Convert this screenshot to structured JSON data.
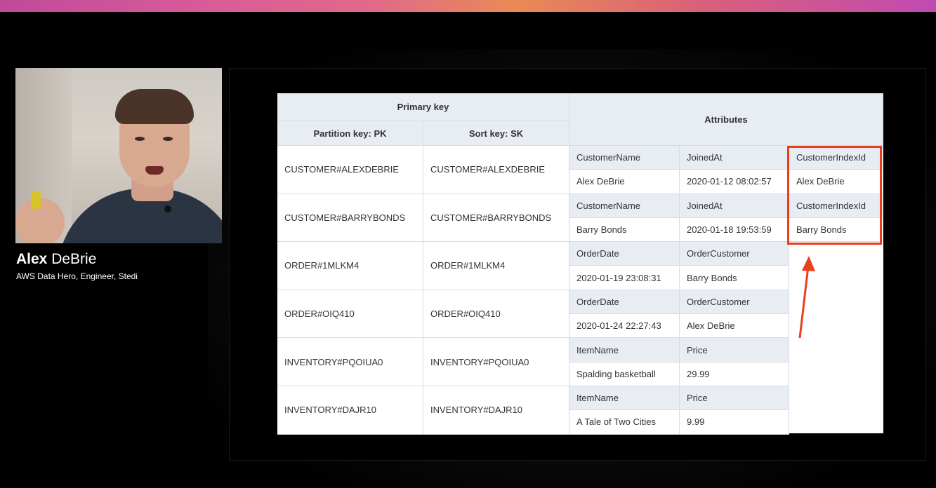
{
  "speaker": {
    "first_name": "Alex",
    "last_name": "DeBrie",
    "title": "AWS Data Hero, Engineer, Stedi"
  },
  "table": {
    "header_primary_key": "Primary key",
    "header_partition_key": "Partition key: PK",
    "header_sort_key": "Sort key: SK",
    "header_attributes": "Attributes",
    "items": [
      {
        "pk": "CUSTOMER#ALEXDEBRIE",
        "sk": "CUSTOMER#ALEXDEBRIE",
        "a1_name": "CustomerName",
        "a1_val": "Alex DeBrie",
        "a2_name": "JoinedAt",
        "a2_val": "2020-01-12 08:02:57",
        "a3_name": "CustomerIndexId",
        "a3_val": "Alex DeBrie"
      },
      {
        "pk": "CUSTOMER#BARRYBONDS",
        "sk": "CUSTOMER#BARRYBONDS",
        "a1_name": "CustomerName",
        "a1_val": "Barry Bonds",
        "a2_name": "JoinedAt",
        "a2_val": "2020-01-18 19:53:59",
        "a3_name": "CustomerIndexId",
        "a3_val": "Barry Bonds"
      },
      {
        "pk": "ORDER#1MLKM4",
        "sk": "ORDER#1MLKM4",
        "a1_name": "OrderDate",
        "a1_val": "2020-01-19 23:08:31",
        "a2_name": "OrderCustomer",
        "a2_val": "Barry Bonds"
      },
      {
        "pk": "ORDER#OIQ410",
        "sk": "ORDER#OIQ410",
        "a1_name": "OrderDate",
        "a1_val": "2020-01-24 22:27:43",
        "a2_name": "OrderCustomer",
        "a2_val": "Alex DeBrie"
      },
      {
        "pk": "INVENTORY#PQOIUA0",
        "sk": "INVENTORY#PQOIUA0",
        "a1_name": "ItemName",
        "a1_val": "Spalding basketball",
        "a2_name": "Price",
        "a2_val": "29.99"
      },
      {
        "pk": "INVENTORY#DAJR10",
        "sk": "INVENTORY#DAJR10",
        "a1_name": "ItemName",
        "a1_val": "A Tale of Two Cities",
        "a2_name": "Price",
        "a2_val": "9.99"
      }
    ]
  },
  "colors": {
    "highlight": "#e8401c",
    "header_bg": "#e8ecf3"
  }
}
